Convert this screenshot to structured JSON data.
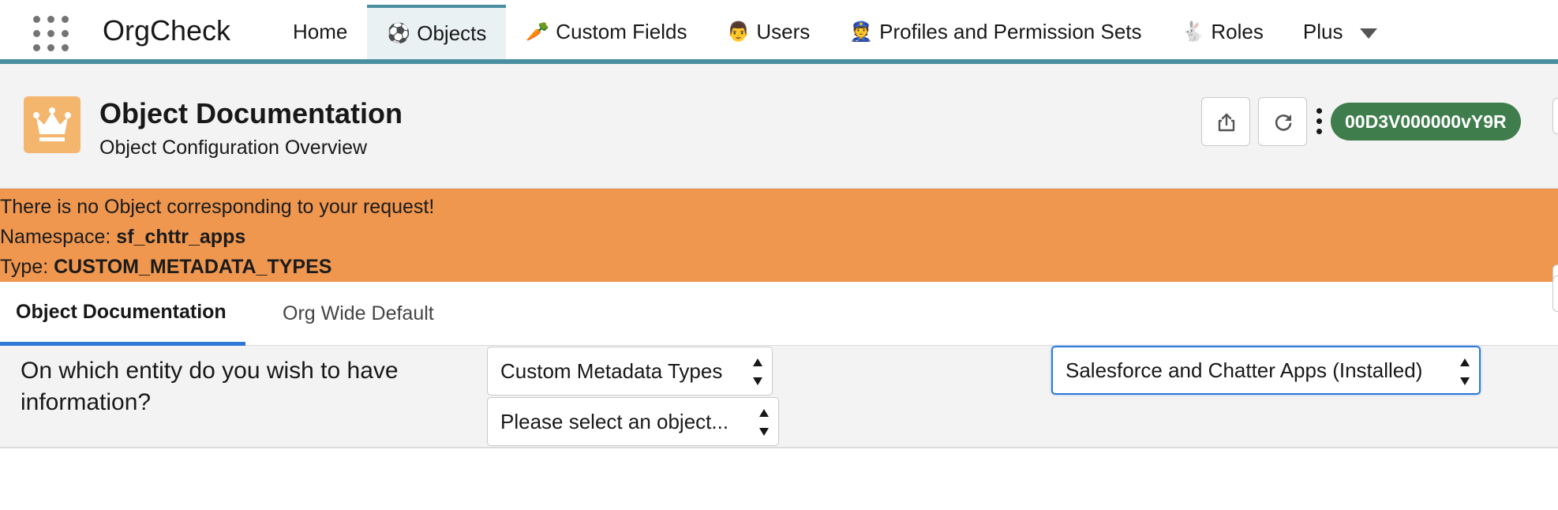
{
  "app": {
    "name": "OrgCheck"
  },
  "nav": {
    "items": [
      {
        "icon": "",
        "label": "Home"
      },
      {
        "icon": "⚽",
        "label": "Objects"
      },
      {
        "icon": "🥕",
        "label": "Custom Fields"
      },
      {
        "icon": "👨",
        "label": "Users"
      },
      {
        "icon": "👮",
        "label": "Profiles and Permission Sets"
      },
      {
        "icon": "🐇",
        "label": "Roles"
      },
      {
        "icon": "",
        "label": "Plus"
      }
    ],
    "active_index": 1
  },
  "header": {
    "title": "Object Documentation",
    "subtitle": "Object Configuration Overview",
    "org_id": "00D3V000000vY9R",
    "icon": "crown-icon"
  },
  "banner": {
    "message": "There is no Object corresponding to your request!",
    "namespace_label": "Namespace: ",
    "namespace_value": "sf_chttr_apps",
    "type_label": "Type: ",
    "type_value": "CUSTOM_METADATA_TYPES",
    "color": "#ef974f"
  },
  "tabs": [
    {
      "label": "Object Documentation",
      "active": true
    },
    {
      "label": "Org Wide Default",
      "active": false
    }
  ],
  "selection": {
    "question": "On which entity do you wish to have information?",
    "type_select": "Custom Metadata Types",
    "object_select": "Please select an object...",
    "package_select": "Salesforce and Chatter Apps (Installed)"
  },
  "colors": {
    "accent": "#4a8fa0",
    "org_badge": "#3f7d4c",
    "tab_underline": "#2f78d8",
    "page_icon": "#f4b56d"
  }
}
